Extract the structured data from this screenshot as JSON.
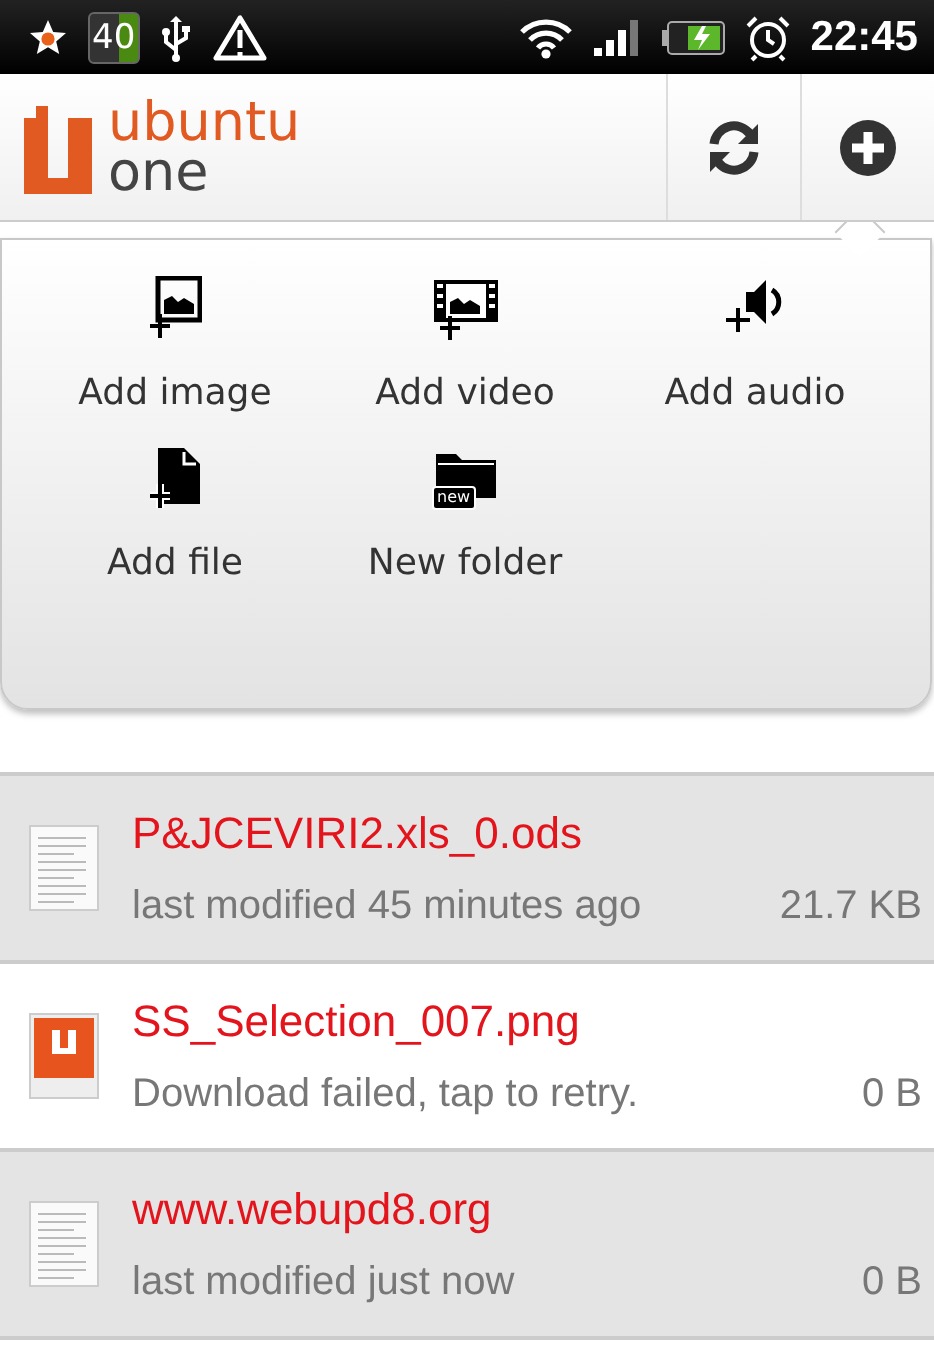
{
  "status_bar": {
    "badge": "40",
    "time": "22:45"
  },
  "header": {
    "logo_top": "ubuntu",
    "logo_bottom": "one"
  },
  "add_menu": {
    "items": [
      {
        "kind": "image",
        "label": "Add image"
      },
      {
        "kind": "video",
        "label": "Add video"
      },
      {
        "kind": "audio",
        "label": "Add audio"
      },
      {
        "kind": "file",
        "label": "Add file"
      },
      {
        "kind": "folder",
        "label": "New folder",
        "icon_text": "new"
      }
    ]
  },
  "files": [
    {
      "kind": "document",
      "shaded": true,
      "name": "P&JCEVIRI2.xls_0.ods",
      "status": "last modified 45 minutes ago",
      "size": "21.7 KB"
    },
    {
      "kind": "image",
      "shaded": false,
      "name": "SS_Selection_007.png",
      "status": "Download failed, tap to retry.",
      "size": "0 B"
    },
    {
      "kind": "document",
      "shaded": true,
      "name": "www.webupd8.org",
      "status": "last modified just now",
      "size": "0 B"
    }
  ]
}
